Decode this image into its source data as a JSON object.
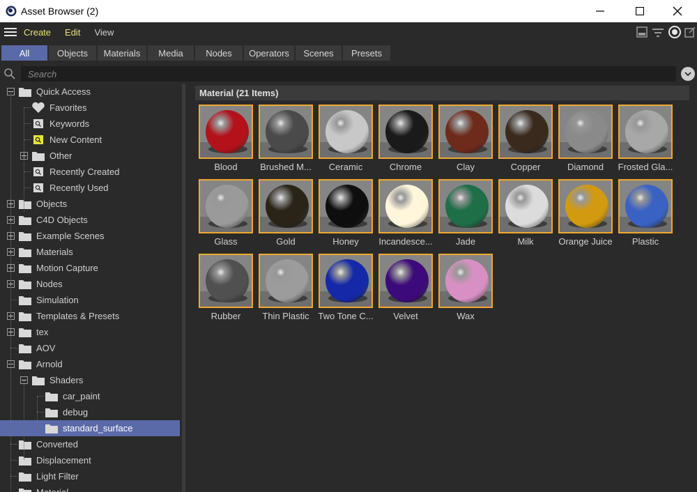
{
  "window": {
    "title": "Asset Browser (2)"
  },
  "menu": {
    "items": [
      "Create",
      "Edit",
      "View"
    ]
  },
  "tabs": [
    "All",
    "Objects",
    "Materials",
    "Media",
    "Nodes",
    "Operators",
    "Scenes",
    "Presets"
  ],
  "active_tab": "All",
  "search": {
    "placeholder": "Search"
  },
  "tree": {
    "items": [
      {
        "label": "Quick Access",
        "icon": "folder-icon"
      },
      {
        "label": "Favorites",
        "icon": "heart-icon"
      },
      {
        "label": "Keywords",
        "icon": "search-folder-icon"
      },
      {
        "label": "New Content",
        "icon": "search-folder-highlight-icon"
      },
      {
        "label": "Other",
        "icon": "folder-icon"
      },
      {
        "label": "Recently Created",
        "icon": "search-folder-icon"
      },
      {
        "label": "Recently Used",
        "icon": "search-folder-icon"
      },
      {
        "label": "Objects",
        "icon": "folder-icon"
      },
      {
        "label": "C4D Objects",
        "icon": "folder-icon"
      },
      {
        "label": "Example Scenes",
        "icon": "folder-icon"
      },
      {
        "label": "Materials",
        "icon": "folder-icon"
      },
      {
        "label": "Motion Capture",
        "icon": "folder-icon"
      },
      {
        "label": "Nodes",
        "icon": "folder-icon"
      },
      {
        "label": "Simulation",
        "icon": "folder-icon"
      },
      {
        "label": "Templates & Presets",
        "icon": "folder-icon"
      },
      {
        "label": "tex",
        "icon": "folder-icon"
      },
      {
        "label": "AOV",
        "icon": "folder-icon"
      },
      {
        "label": "Arnold",
        "icon": "folder-icon"
      },
      {
        "label": "Shaders",
        "icon": "folder-icon"
      },
      {
        "label": "car_paint",
        "icon": "folder-icon"
      },
      {
        "label": "debug",
        "icon": "folder-icon"
      },
      {
        "label": "standard_surface",
        "icon": "folder-icon"
      },
      {
        "label": "Converted",
        "icon": "folder-icon"
      },
      {
        "label": "Displacement",
        "icon": "folder-icon"
      },
      {
        "label": "Light Filter",
        "icon": "folder-icon"
      },
      {
        "label": "Material",
        "icon": "folder-icon"
      }
    ],
    "selected": "standard_surface"
  },
  "content": {
    "group_title": "Material (21 Items)",
    "assets": [
      {
        "label": "Blood",
        "color": "#b3121a"
      },
      {
        "label": "Brushed M...",
        "color": "#4a4a4a"
      },
      {
        "label": "Ceramic",
        "color": "#c8c8c8"
      },
      {
        "label": "Chrome",
        "color": "#1a1a1a"
      },
      {
        "label": "Clay",
        "color": "#6e2a1a"
      },
      {
        "label": "Copper",
        "color": "#3a2a1e"
      },
      {
        "label": "Diamond",
        "color": "#8a8a8a"
      },
      {
        "label": "Frosted Gla...",
        "color": "#a8a8a8"
      },
      {
        "label": "Glass",
        "color": "#9a9a9a"
      },
      {
        "label": "Gold",
        "color": "#2a2418"
      },
      {
        "label": "Honey",
        "color": "#0e0e0e"
      },
      {
        "label": "Incandesce...",
        "color": "#fff6dc"
      },
      {
        "label": "Jade",
        "color": "#1e6e48"
      },
      {
        "label": "Milk",
        "color": "#dcdcdc"
      },
      {
        "label": "Orange Juice",
        "color": "#d29a10"
      },
      {
        "label": "Plastic",
        "color": "#3a62c2"
      },
      {
        "label": "Rubber",
        "color": "#505050"
      },
      {
        "label": "Thin Plastic",
        "color": "#9c9c9c"
      },
      {
        "label": "Two Tone C...",
        "color": "#1428a8"
      },
      {
        "label": "Velvet",
        "color": "#3c0a7a"
      },
      {
        "label": "Wax",
        "color": "#d890c4"
      }
    ]
  },
  "colors": {
    "accent": "#5a6aa8",
    "thumb_border": "#f0a830",
    "menu_highlight": "#e6e27a"
  }
}
